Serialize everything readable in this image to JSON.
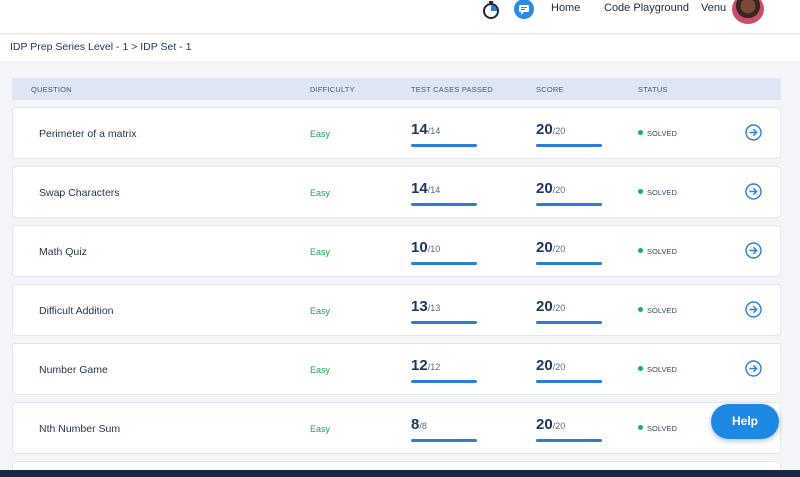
{
  "nav": {
    "home": "Home",
    "playground": "Code Playground",
    "user_name": "Venu"
  },
  "breadcrumb": "IDP Prep Series Level - 1 > IDP Set - 1",
  "table": {
    "headers": {
      "question": "QUESTION",
      "difficulty": "DIFFICULTY",
      "tests": "TEST CASES PASSED",
      "score": "SCORE",
      "status": "STATUS"
    },
    "rows": [
      {
        "title": "Perimeter of a matrix",
        "difficulty": "Easy",
        "tests_passed": "14",
        "tests_total": "/14",
        "score": "20",
        "score_total": "/20",
        "status": "SOLVED"
      },
      {
        "title": "Swap Characters",
        "difficulty": "Easy",
        "tests_passed": "14",
        "tests_total": "/14",
        "score": "20",
        "score_total": "/20",
        "status": "SOLVED"
      },
      {
        "title": "Math Quiz",
        "difficulty": "Easy",
        "tests_passed": "10",
        "tests_total": "/10",
        "score": "20",
        "score_total": "/20",
        "status": "SOLVED"
      },
      {
        "title": "Difficult Addition",
        "difficulty": "Easy",
        "tests_passed": "13",
        "tests_total": "/13",
        "score": "20",
        "score_total": "/20",
        "status": "SOLVED"
      },
      {
        "title": "Number Game",
        "difficulty": "Easy",
        "tests_passed": "12",
        "tests_total": "/12",
        "score": "20",
        "score_total": "/20",
        "status": "SOLVED"
      },
      {
        "title": "Nth Number Sum",
        "difficulty": "Easy",
        "tests_passed": "8",
        "tests_total": "/8",
        "score": "20",
        "score_total": "/20",
        "status": "SOLVED"
      }
    ]
  },
  "help_label": "Help",
  "colors": {
    "accent": "#1e88e5",
    "easy": "#23a65a",
    "solved_dot": "#16b069",
    "progress": "#2b7fd9"
  }
}
